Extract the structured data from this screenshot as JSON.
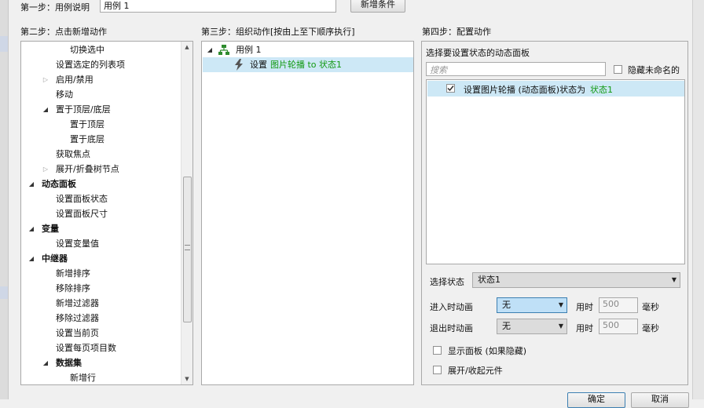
{
  "step1": {
    "label": "第一步：用例说明",
    "case_name": "用例 1",
    "add_condition_button": "新增条件"
  },
  "step2": {
    "label": "第二步：点击新增动作",
    "items": [
      {
        "text": "切换选中",
        "level": 3,
        "toggle": "",
        "bold": false
      },
      {
        "text": "设置选定的列表项",
        "level": 2,
        "toggle": "",
        "bold": false
      },
      {
        "text": "启用/禁用",
        "level": 2,
        "toggle": "closed",
        "bold": false
      },
      {
        "text": "移动",
        "level": 2,
        "toggle": "",
        "bold": false
      },
      {
        "text": "置于顶层/底层",
        "level": 2,
        "toggle": "open",
        "bold": false
      },
      {
        "text": "置于顶层",
        "level": 3,
        "toggle": "",
        "bold": false
      },
      {
        "text": "置于底层",
        "level": 3,
        "toggle": "",
        "bold": false
      },
      {
        "text": "获取焦点",
        "level": 2,
        "toggle": "",
        "bold": false
      },
      {
        "text": "展开/折叠树节点",
        "level": 2,
        "toggle": "closed",
        "bold": false
      },
      {
        "text": "动态面板",
        "level": 1,
        "toggle": "open",
        "bold": true
      },
      {
        "text": "设置面板状态",
        "level": 2,
        "toggle": "",
        "bold": false
      },
      {
        "text": "设置面板尺寸",
        "level": 2,
        "toggle": "",
        "bold": false
      },
      {
        "text": "变量",
        "level": 1,
        "toggle": "open",
        "bold": true
      },
      {
        "text": "设置变量值",
        "level": 2,
        "toggle": "",
        "bold": false
      },
      {
        "text": "中继器",
        "level": 1,
        "toggle": "open",
        "bold": true
      },
      {
        "text": "新增排序",
        "level": 2,
        "toggle": "",
        "bold": false
      },
      {
        "text": "移除排序",
        "level": 2,
        "toggle": "",
        "bold": false
      },
      {
        "text": "新增过滤器",
        "level": 2,
        "toggle": "",
        "bold": false
      },
      {
        "text": "移除过滤器",
        "level": 2,
        "toggle": "",
        "bold": false
      },
      {
        "text": "设置当前页",
        "level": 2,
        "toggle": "",
        "bold": false
      },
      {
        "text": "设置每页项目数",
        "level": 2,
        "toggle": "",
        "bold": false
      },
      {
        "text": "数据集",
        "level": 2,
        "toggle": "open",
        "bold": true
      },
      {
        "text": "新增行",
        "level": 3,
        "toggle": "",
        "bold": false
      }
    ]
  },
  "step3": {
    "label": "第三步：组织动作[按由上至下顺序执行]",
    "case_label": "用例 1",
    "action_prefix": "设置",
    "action_target": "图片轮播 to 状态1"
  },
  "step4": {
    "label": "第四步：配置动作",
    "panel_title": "选择要设置状态的动态面板",
    "search_placeholder": "搜索",
    "hide_unnamed": "隐藏未命名的",
    "panel_item_text": "设置图片轮播 (动态面板)状态为",
    "panel_item_state": "状态1",
    "select_state_label": "选择状态",
    "select_state_value": "状态1",
    "enter_anim_label": "进入时动画",
    "enter_anim_value": "无",
    "exit_anim_label": "退出时动画",
    "exit_anim_value": "无",
    "duration_label": "用时",
    "duration_value_enter": "500",
    "duration_value_exit": "500",
    "ms_label": "毫秒",
    "show_panel": "显示面板 (如果隐藏)",
    "expand_widget": "展开/收起元件"
  },
  "footer": {
    "ok_button": "确定",
    "cancel_button": "取消"
  },
  "colors": {
    "selected_bg": "#cde8f6",
    "green_text": "#119911",
    "dropdown_highlight": "#bfe0f7"
  }
}
